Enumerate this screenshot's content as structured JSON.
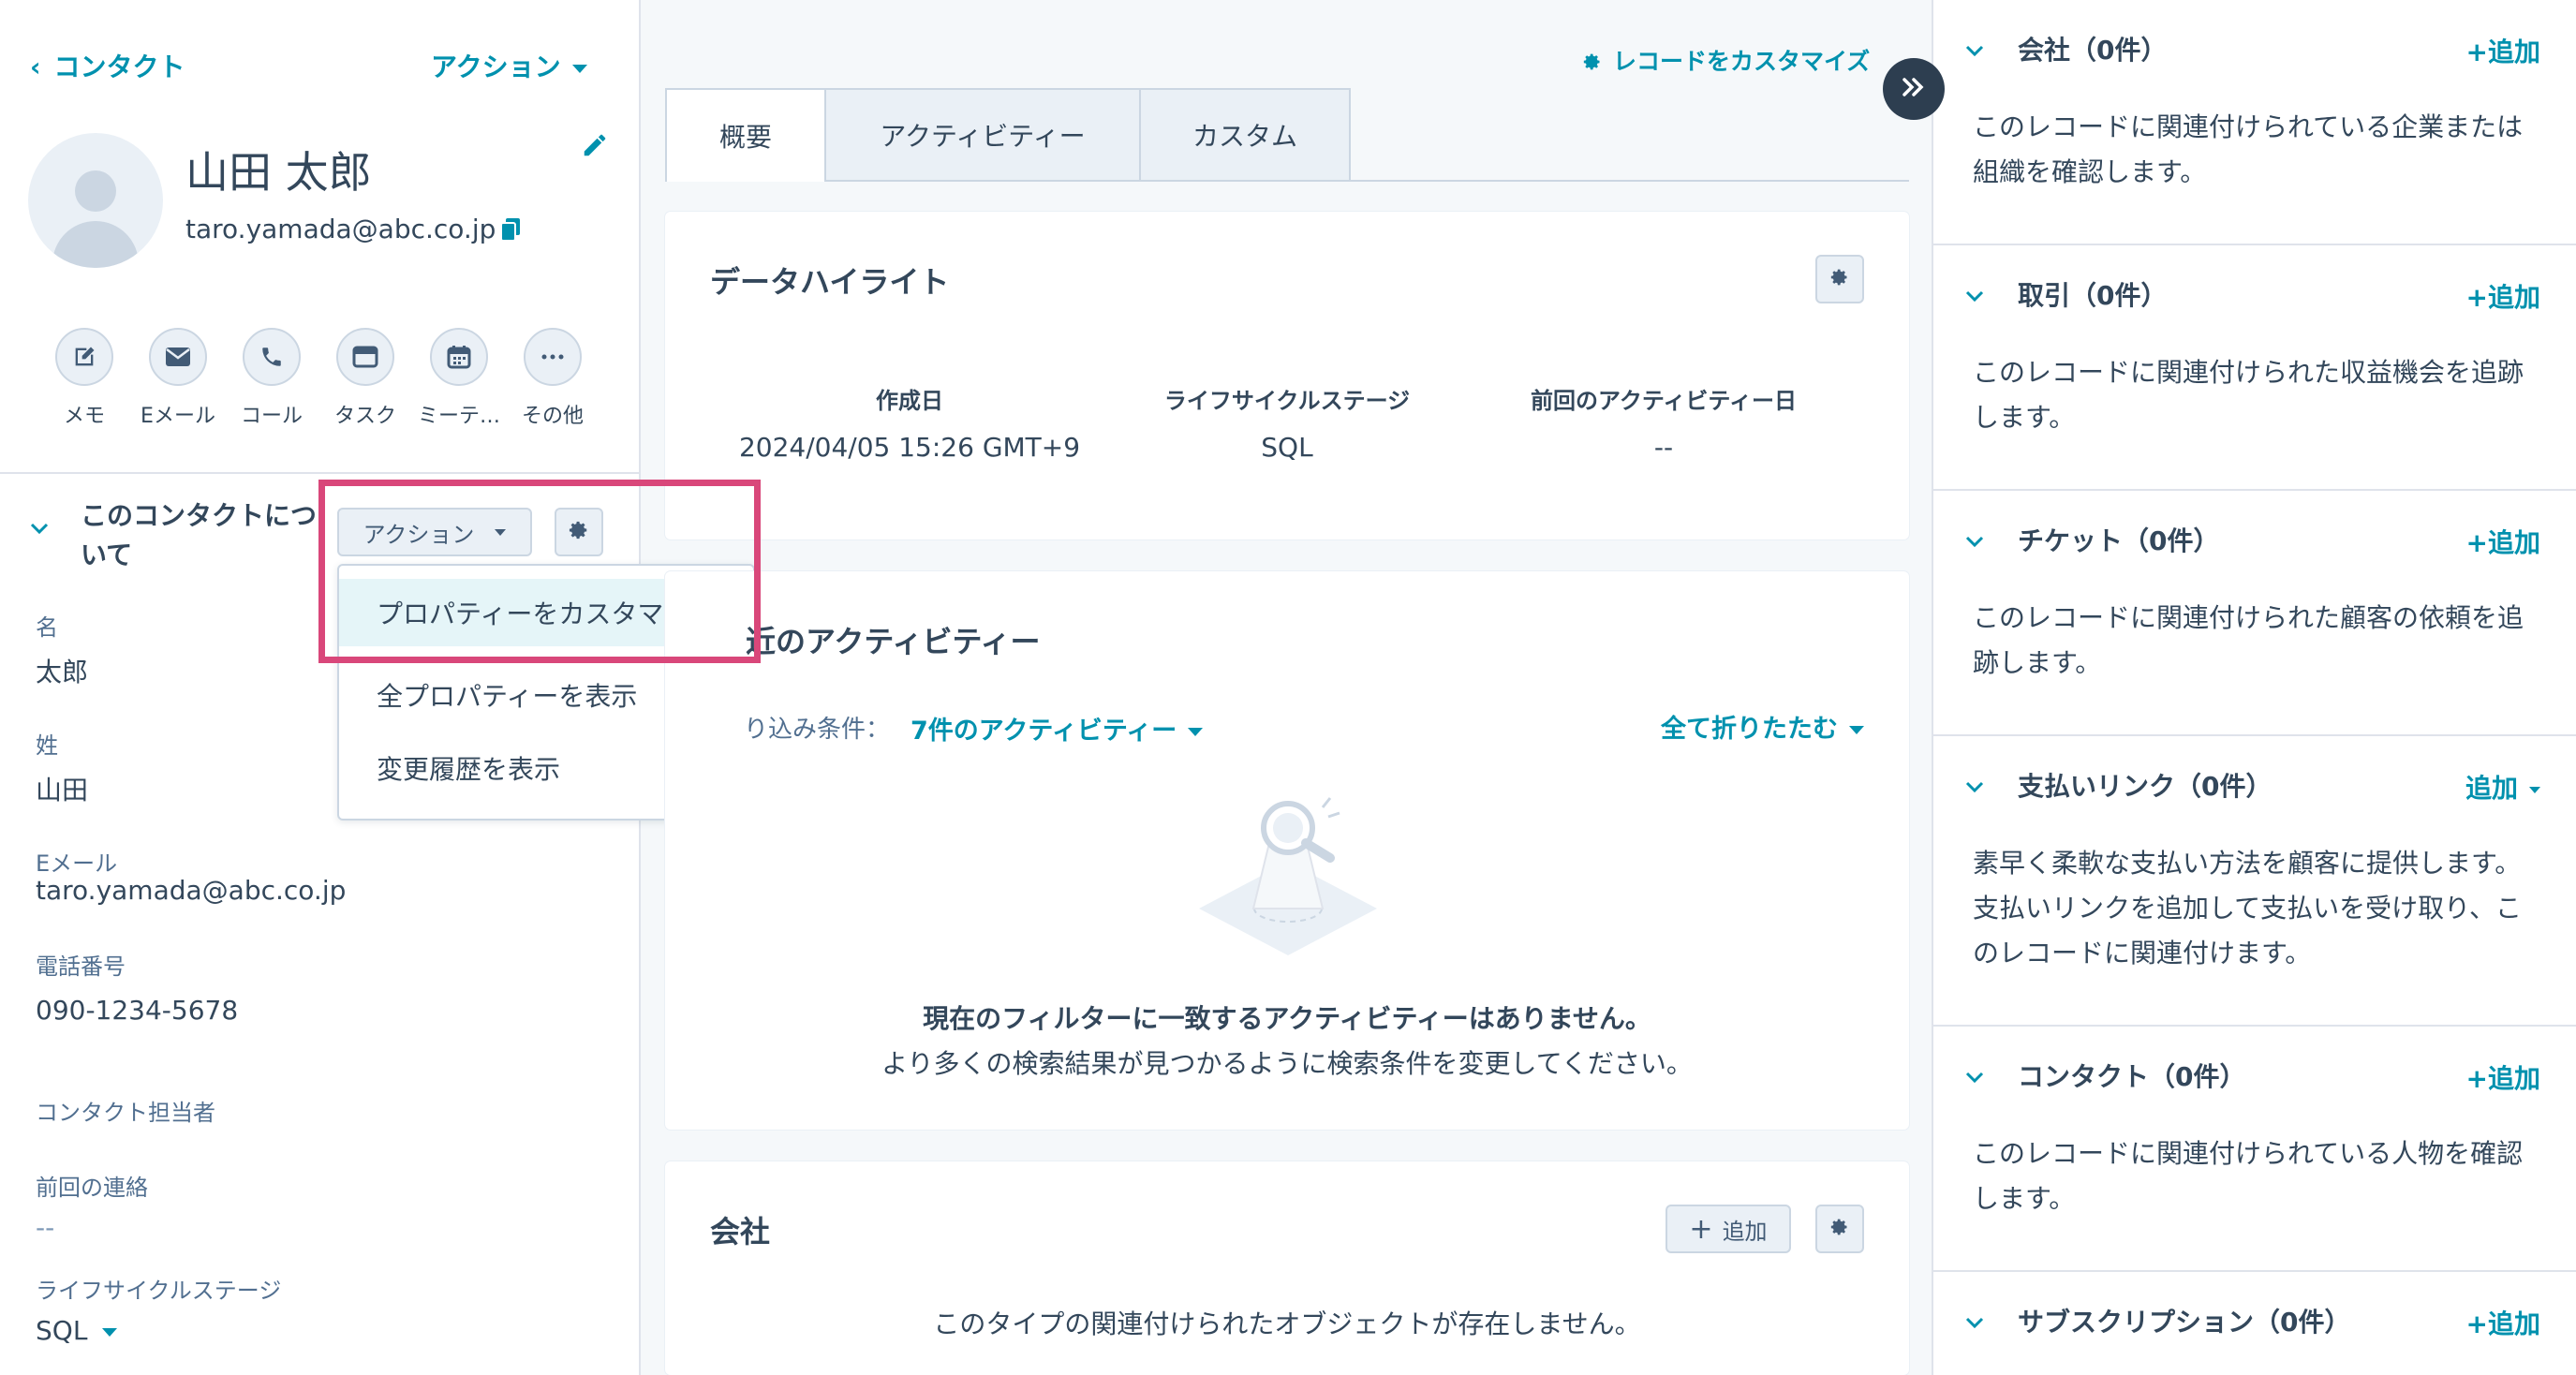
{
  "left": {
    "back_label": "コンタクト",
    "actions_label": "アクション",
    "name": "山田 太郎",
    "email": "taro.yamada@abc.co.jp",
    "quick_actions": [
      {
        "label": "メモ",
        "icon": "edit-note-icon"
      },
      {
        "label": "Eメール",
        "icon": "email-icon"
      },
      {
        "label": "コール",
        "icon": "phone-icon"
      },
      {
        "label": "タスク",
        "icon": "task-icon"
      },
      {
        "label": "ミーテ…",
        "icon": "calendar-icon"
      },
      {
        "label": "その他",
        "icon": "more-icon"
      }
    ],
    "about": {
      "title": "このコンタクトについて",
      "action_label": "アクション",
      "properties": [
        {
          "label": "名",
          "value": "太郎"
        },
        {
          "label": "姓",
          "value": "山田"
        },
        {
          "label": "Eメール",
          "value": "taro.yamada@abc.co.jp"
        },
        {
          "label": "電話番号",
          "value": "090-1234-5678"
        },
        {
          "label": "コンタクト担当者",
          "value": ""
        },
        {
          "label": "前回の連絡",
          "value": "--"
        },
        {
          "label": "ライフサイクルステージ",
          "value": "SQL"
        }
      ]
    },
    "dropdown": {
      "items": [
        "プロパティーをカスタマイズ",
        "全プロパティーを表示",
        "変更履歴を表示"
      ]
    }
  },
  "middle": {
    "customize_label": "レコードをカスタマイズ",
    "tabs": [
      "概要",
      "アクティビティー",
      "カスタム"
    ],
    "highlights": {
      "title": "データハイライト",
      "columns": [
        {
          "label": "作成日",
          "value": "2024/04/05 15:26 GMT+9"
        },
        {
          "label": "ライフサイクルステージ",
          "value": "SQL"
        },
        {
          "label": "前回のアクティビティー日",
          "value": "--"
        }
      ]
    },
    "activity": {
      "title": "近のアクティビティー",
      "filter_label": "り込み条件：",
      "filter_value": "7件のアクティビティー",
      "collapse_all": "全て折りたたむ",
      "empty_title": "現在のフィルターに一致するアクティビティーはありません。",
      "empty_desc": "より多くの検索結果が見つかるように検索条件を変更してください。"
    },
    "company": {
      "title": "会社",
      "add_label": "追加",
      "empty": "このタイプの関連付けられたオブジェクトが存在しません。"
    }
  },
  "right": {
    "sections": [
      {
        "title": "会社（0件）",
        "add": "+追加",
        "desc": "このレコードに関連付けられている企業または組織を確認します。"
      },
      {
        "title": "取引（0件）",
        "add": "+追加",
        "desc": "このレコードに関連付けられた収益機会を追跡します。"
      },
      {
        "title": "チケット（0件）",
        "add": "+追加",
        "desc": "このレコードに関連付けられた顧客の依頼を追跡します。"
      },
      {
        "title": "支払いリンク（0件）",
        "add": "追加",
        "desc": "素早く柔軟な支払い方法を顧客に提供します。支払いリンクを追加して支払いを受け取り、このレコードに関連付けます。"
      },
      {
        "title": "コンタクト（0件）",
        "add": "+追加",
        "desc": "このレコードに関連付けられている人物を確認します。"
      },
      {
        "title": "サブスクリプション（0件）",
        "add": "+追加",
        "desc": ""
      }
    ]
  },
  "colors": {
    "accent": "#0091ae",
    "text": "#33475b",
    "highlight_border": "#d9477a"
  }
}
